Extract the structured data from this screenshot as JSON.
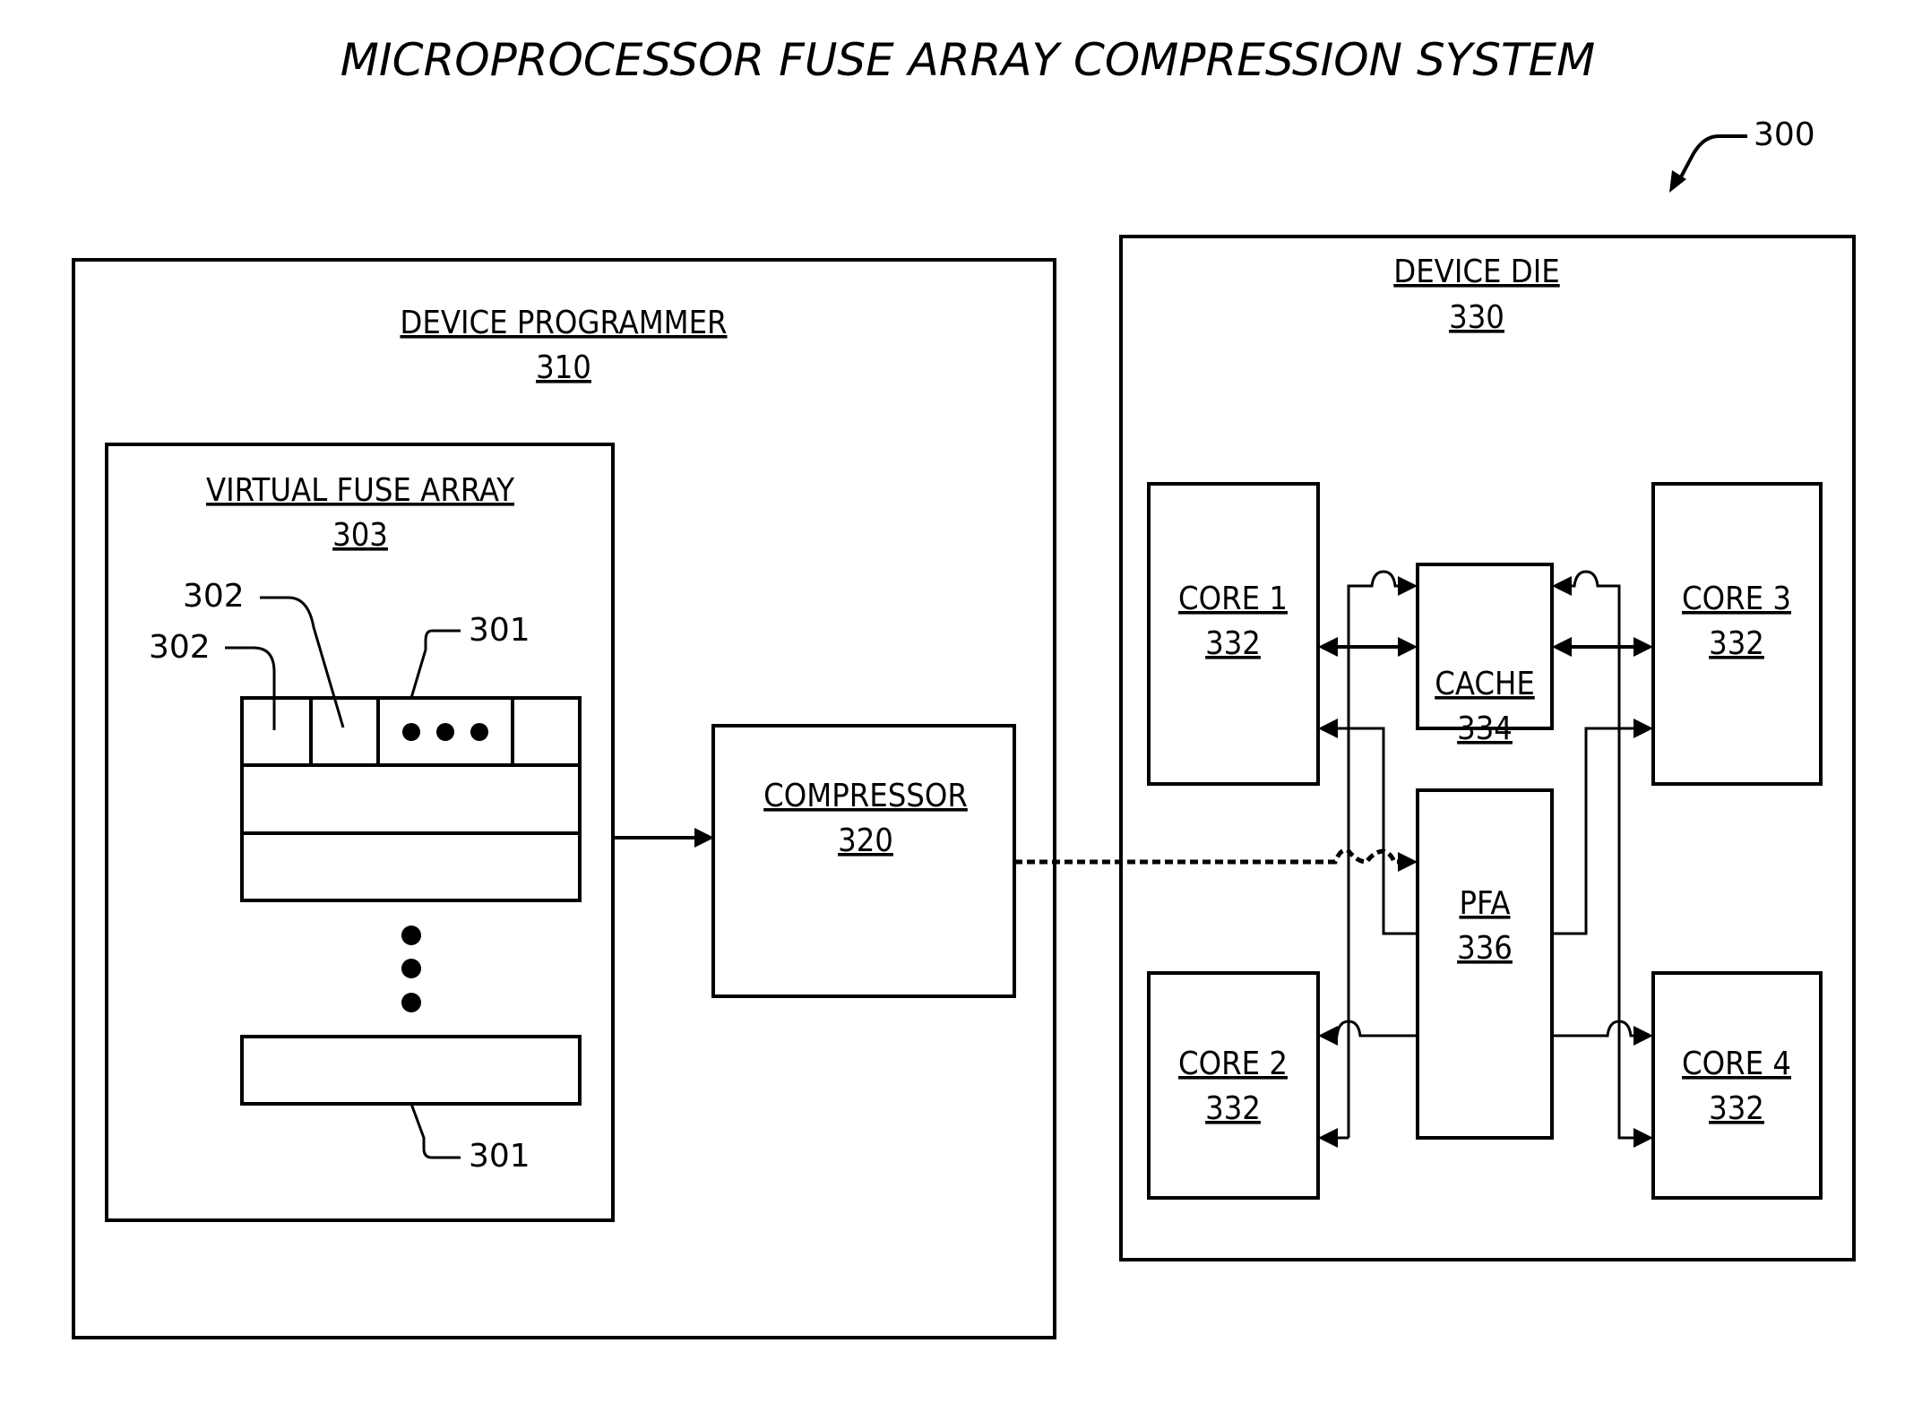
{
  "title": "MICROPROCESSOR FUSE ARRAY COMPRESSION SYSTEM",
  "figure_ref": "300",
  "device_programmer": {
    "label": "DEVICE PROGRAMMER",
    "ref": "310"
  },
  "virtual_fuse_array": {
    "label": "VIRTUAL FUSE ARRAY",
    "ref": "303",
    "fuse_ref": "302",
    "row_ref": "301"
  },
  "compressor": {
    "label": "COMPRESSOR",
    "ref": "320"
  },
  "device_die": {
    "label": "DEVICE DIE",
    "ref": "330"
  },
  "cores": [
    {
      "label": "CORE 1",
      "ref": "332"
    },
    {
      "label": "CORE 2",
      "ref": "332"
    },
    {
      "label": "CORE 3",
      "ref": "332"
    },
    {
      "label": "CORE 4",
      "ref": "332"
    }
  ],
  "cache": {
    "label": "CACHE",
    "ref": "334"
  },
  "pfa": {
    "label": "PFA",
    "ref": "336"
  }
}
